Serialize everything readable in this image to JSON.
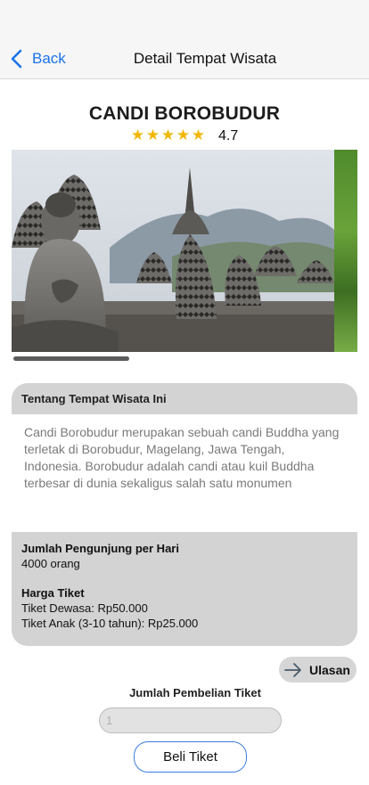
{
  "nav": {
    "back_label": "Back",
    "title": "Detail Tempat Wisata"
  },
  "place": {
    "name": "CANDI BOROBUDUR",
    "rating": "4.7",
    "stars_filled": 5,
    "star_color": "#f2b705"
  },
  "about": {
    "heading": "Tentang Tempat Wisata Ini",
    "description": "Candi Borobudur merupakan sebuah candi Buddha yang terletak di Borobudur, Magelang, Jawa Tengah, Indonesia. Borobudur adalah candi atau kuil Buddha terbesar di dunia sekaligus salah satu monumen"
  },
  "visitors": {
    "label": "Jumlah Pengunjung per Hari",
    "value": "4000 orang"
  },
  "tickets": {
    "label": "Harga Tiket",
    "adult": "Tiket Dewasa: Rp50.000",
    "child": "Tiket Anak (3-10 tahun): Rp25.000"
  },
  "review": {
    "label": "Ulasan",
    "icon": "arrow-right-icon"
  },
  "purchase": {
    "qty_label": "Jumlah Pembelian Tiket",
    "qty_placeholder": "1",
    "buy_label": "Beli Tiket"
  },
  "colors": {
    "accent": "#1a73e8",
    "card_bg": "#d3d3d3",
    "button_border": "#3d7be0"
  }
}
